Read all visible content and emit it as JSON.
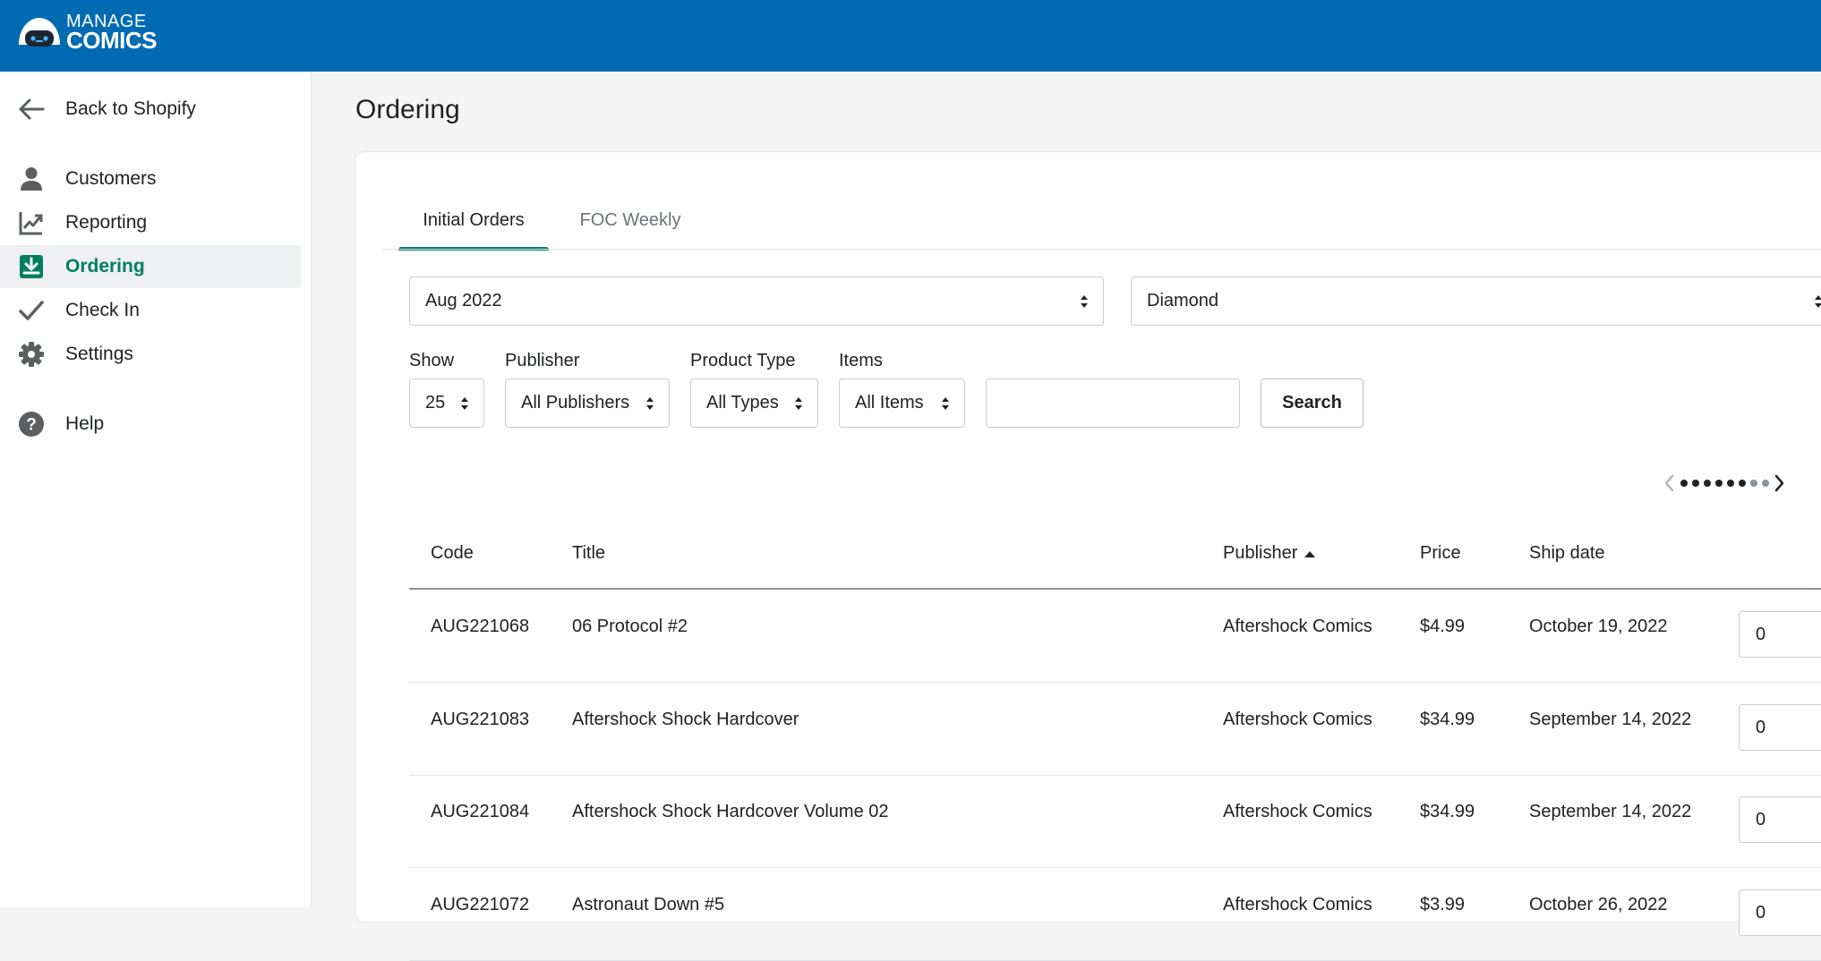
{
  "brand": {
    "line1": "MANAGE",
    "line2": "COMICS"
  },
  "sidebar": {
    "back": "Back to Shopify",
    "items": [
      {
        "label": "Customers",
        "icon": "person-icon"
      },
      {
        "label": "Reporting",
        "icon": "chart-icon"
      },
      {
        "label": "Ordering",
        "icon": "download-icon",
        "active": true
      },
      {
        "label": "Check In",
        "icon": "checkmark-icon"
      },
      {
        "label": "Settings",
        "icon": "gear-icon"
      },
      {
        "label": "Help",
        "icon": "help-icon"
      }
    ]
  },
  "page": {
    "title": "Ordering"
  },
  "tabs": [
    {
      "label": "Initial Orders",
      "selected": true
    },
    {
      "label": "FOC Weekly"
    }
  ],
  "filters": {
    "month": "Aug 2022",
    "distributor": "Diamond",
    "show_label": "Show",
    "show_value": "25",
    "publisher_label": "Publisher",
    "publisher_value": "All Publishers",
    "type_label": "Product Type",
    "type_value": "All Types",
    "items_label": "Items",
    "items_value": "All Items",
    "search_value": "",
    "search_button": "Search"
  },
  "table": {
    "columns": [
      "Code",
      "Title",
      "Publisher",
      "Price",
      "Ship date"
    ],
    "sorted_column": "Publisher",
    "sort_direction": "ascending",
    "rows": [
      {
        "code": "AUG221068",
        "title": "06 Protocol #2",
        "publisher": "Aftershock Comics",
        "price": "$4.99",
        "ship": "October 19, 2022",
        "qty": "0"
      },
      {
        "code": "AUG221083",
        "title": "Aftershock Shock Hardcover",
        "publisher": "Aftershock Comics",
        "price": "$34.99",
        "ship": "September 14, 2022",
        "qty": "0"
      },
      {
        "code": "AUG221084",
        "title": "Aftershock Shock Hardcover Volume 02",
        "publisher": "Aftershock Comics",
        "price": "$34.99",
        "ship": "September 14, 2022",
        "qty": "0"
      },
      {
        "code": "AUG221072",
        "title": "Astronaut Down #5",
        "publisher": "Aftershock Comics",
        "price": "$3.99",
        "ship": "October 26, 2022",
        "qty": "0"
      }
    ]
  },
  "colors": {
    "topbar": "#006bb3",
    "accent": "#008060",
    "active_text": "#007f5f"
  }
}
